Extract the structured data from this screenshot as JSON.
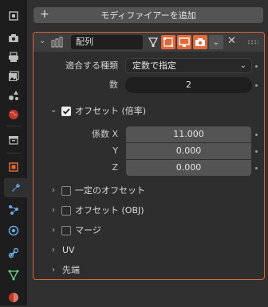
{
  "toolbar_tabs": [
    {
      "name": "tool-tab",
      "icon": "tool-icon"
    },
    {
      "name": "render-tab",
      "icon": "camera-back-icon"
    },
    {
      "name": "output-tab",
      "icon": "printer-icon"
    },
    {
      "name": "view-layer-tab",
      "icon": "images-icon"
    },
    {
      "name": "scene-tab",
      "icon": "scene-icon"
    },
    {
      "name": "world-tab",
      "icon": "world-icon"
    },
    {
      "name": "collection-tab",
      "icon": "collection-icon"
    },
    {
      "name": "object-tab",
      "icon": "object-icon"
    },
    {
      "name": "modifier-tab",
      "icon": "wrench-icon"
    },
    {
      "name": "particles-tab",
      "icon": "particles-icon"
    },
    {
      "name": "physics-tab",
      "icon": "physics-icon"
    },
    {
      "name": "constraints-tab",
      "icon": "constraint-icon"
    },
    {
      "name": "data-tab",
      "icon": "mesh-data-icon"
    },
    {
      "name": "material-tab",
      "icon": "material-icon"
    }
  ],
  "add_modifier_label": "モディファイアーを追加",
  "modifier": {
    "name": "配列",
    "fit_type_label": "適合する種類",
    "fit_type_value": "定数で指定",
    "count_label": "数",
    "count_value": "2",
    "relative_offset": {
      "label": "オフセット (倍率)",
      "checked": true,
      "factor_label": "係数 X",
      "y_label": "Y",
      "z_label": "Z",
      "x": "11.000",
      "y": "0.000",
      "z": "0.000"
    },
    "sections": [
      {
        "label": "一定のオフセット",
        "checkbox": true
      },
      {
        "label": "オフセット (OBJ)",
        "checkbox": true
      },
      {
        "label": "マージ",
        "checkbox": true
      },
      {
        "label": "UV",
        "checkbox": false
      },
      {
        "label": "先端",
        "checkbox": false
      }
    ]
  },
  "colors": {
    "accent": "#e2693a",
    "panel_border": "#d9673a",
    "bg": "#303030"
  }
}
